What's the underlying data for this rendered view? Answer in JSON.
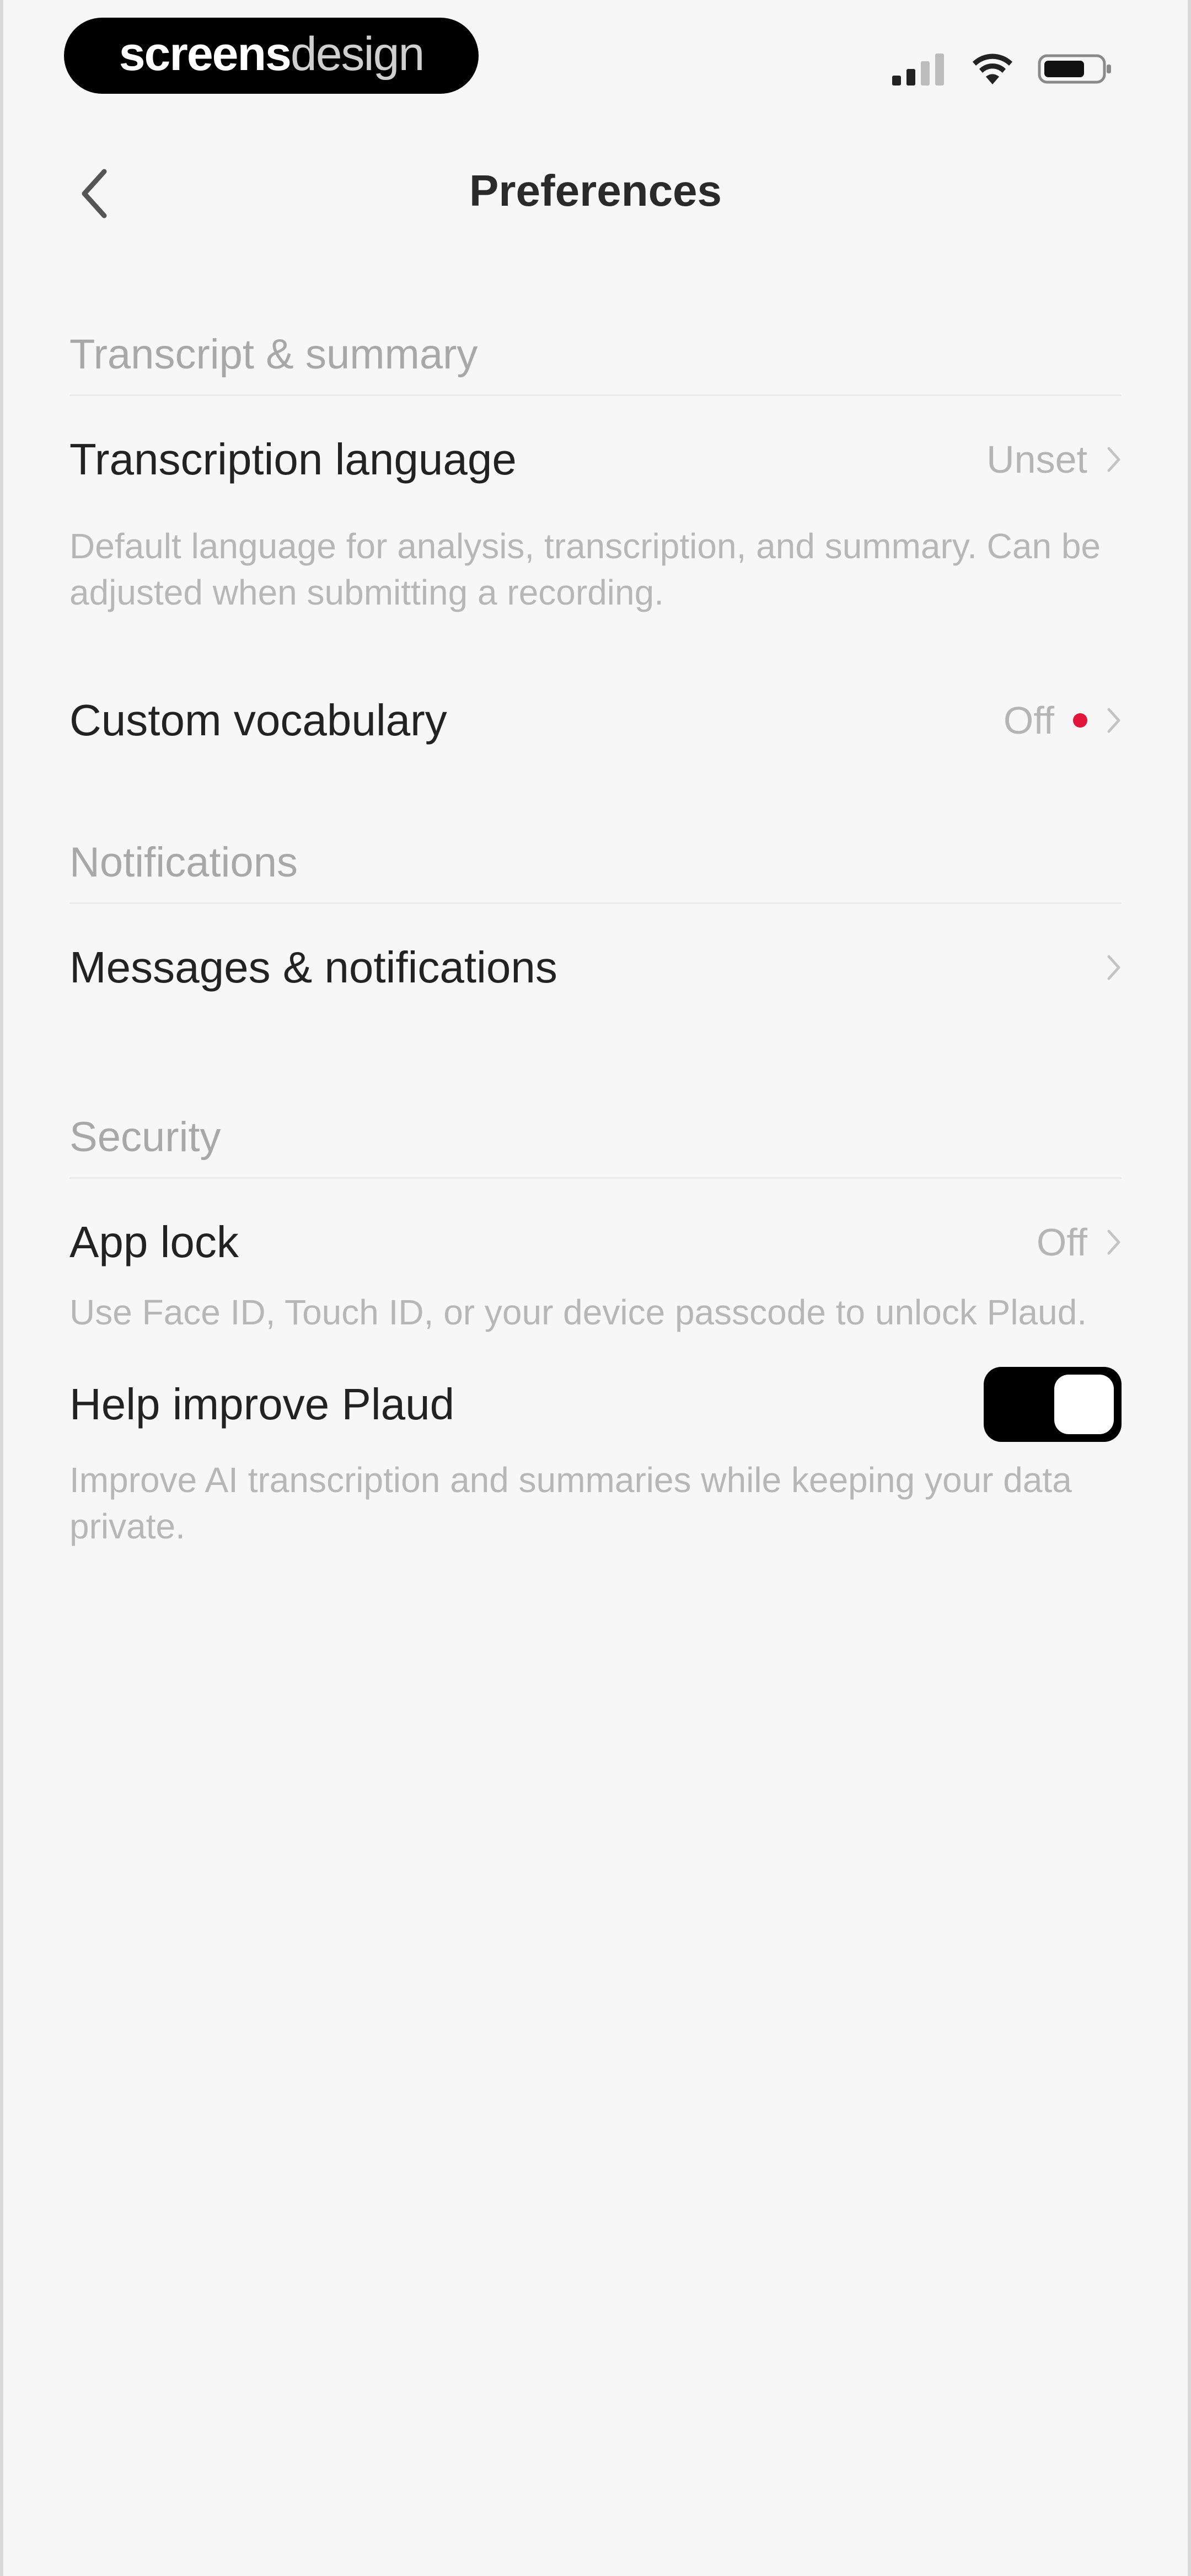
{
  "status_bar": {
    "brand": {
      "bold": "screens",
      "light": "design"
    }
  },
  "navbar": {
    "title": "Preferences"
  },
  "sections": {
    "transcript": {
      "header": "Transcript & summary",
      "transcription_language": {
        "label": "Transcription language",
        "value": "Unset",
        "description": "Default language for analysis, transcription, and summary. Can be adjusted when submitting a recording."
      },
      "custom_vocabulary": {
        "label": "Custom vocabulary",
        "value": "Off"
      }
    },
    "notifications": {
      "header": "Notifications",
      "messages": {
        "label": "Messages & notifications"
      }
    },
    "security": {
      "header": "Security",
      "app_lock": {
        "label": "App lock",
        "value": "Off",
        "description": "Use Face ID, Touch ID, or your device passcode to unlock Plaud."
      },
      "help_improve": {
        "label": "Help improve Plaud",
        "enabled": true,
        "description": "Improve AI transcription and summaries while keeping your data private."
      }
    }
  },
  "colors": {
    "background": "#f7f7f7",
    "toggle_on": "#000000",
    "badge_dot": "#e2163a"
  }
}
